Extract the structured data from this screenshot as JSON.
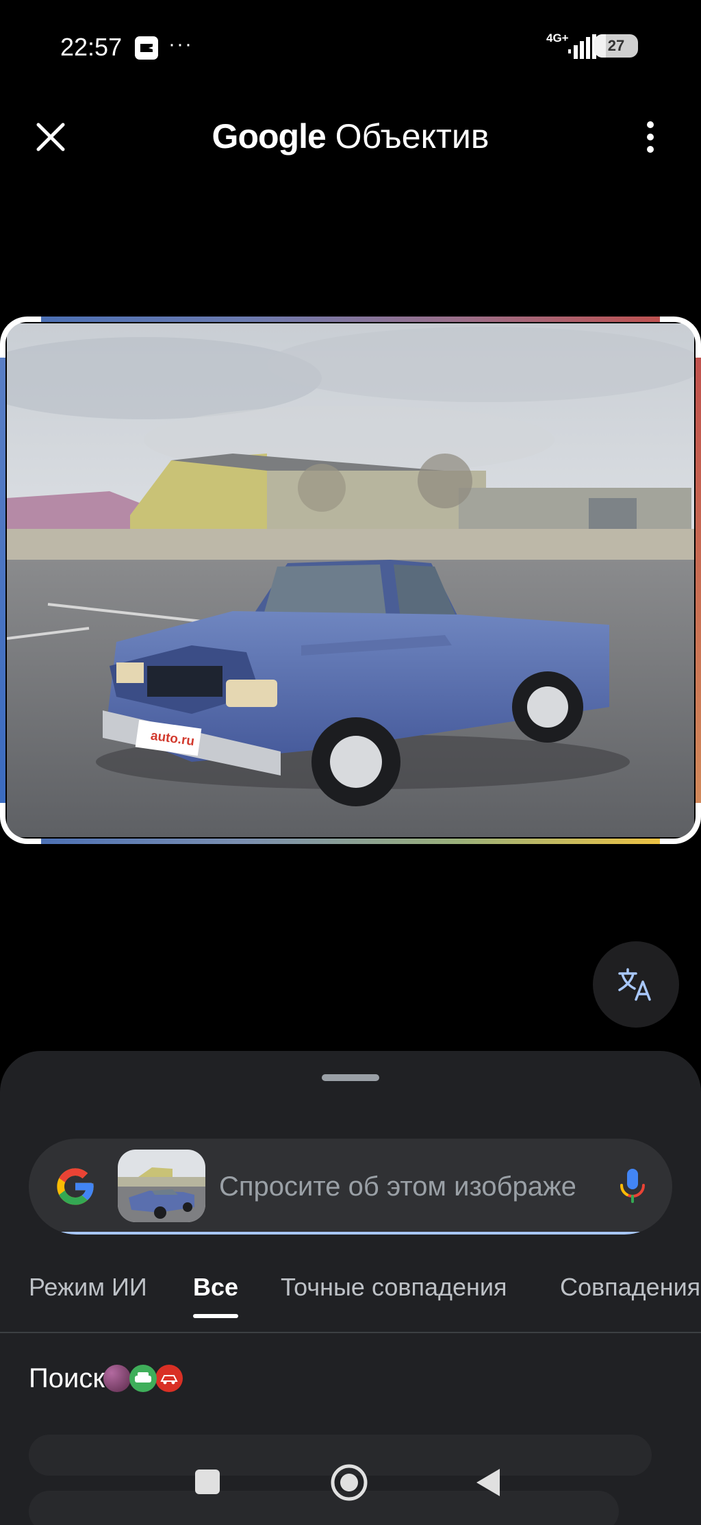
{
  "status_bar": {
    "time": "22:57",
    "dots": "···",
    "network": "4G+",
    "battery_level": "27",
    "battery_percent": 27,
    "icons": [
      "capcut-icon",
      "signal-icon",
      "battery-icon"
    ]
  },
  "header": {
    "brand": "Google",
    "product": "Объектив",
    "icons": [
      "close-icon",
      "more-vert-icon"
    ]
  },
  "image": {
    "plate_text": "auto.ru"
  },
  "translate": {
    "icon": "translate-icon"
  },
  "search": {
    "placeholder": "Спросите об этом изображении",
    "icons": [
      "google-g-icon",
      "mic-icon"
    ]
  },
  "tabs": [
    {
      "label": "Режим ИИ",
      "active": false
    },
    {
      "label": "Все",
      "active": true
    },
    {
      "label": "Точные совпадения",
      "active": false
    },
    {
      "label": "Совпадения",
      "active": false
    }
  ],
  "results": {
    "section_title": "Поиск"
  },
  "nav": {
    "icons": [
      "recents-square-icon",
      "home-circle-icon",
      "back-triangle-icon"
    ]
  },
  "colors": {
    "background": "#000000",
    "sheet": "#202124",
    "search_box": "#303134",
    "accent": "#a8c7fa",
    "google_blue": "#4285F4",
    "google_red": "#EA4335",
    "google_yellow": "#FBBC05",
    "google_green": "#34A853"
  }
}
